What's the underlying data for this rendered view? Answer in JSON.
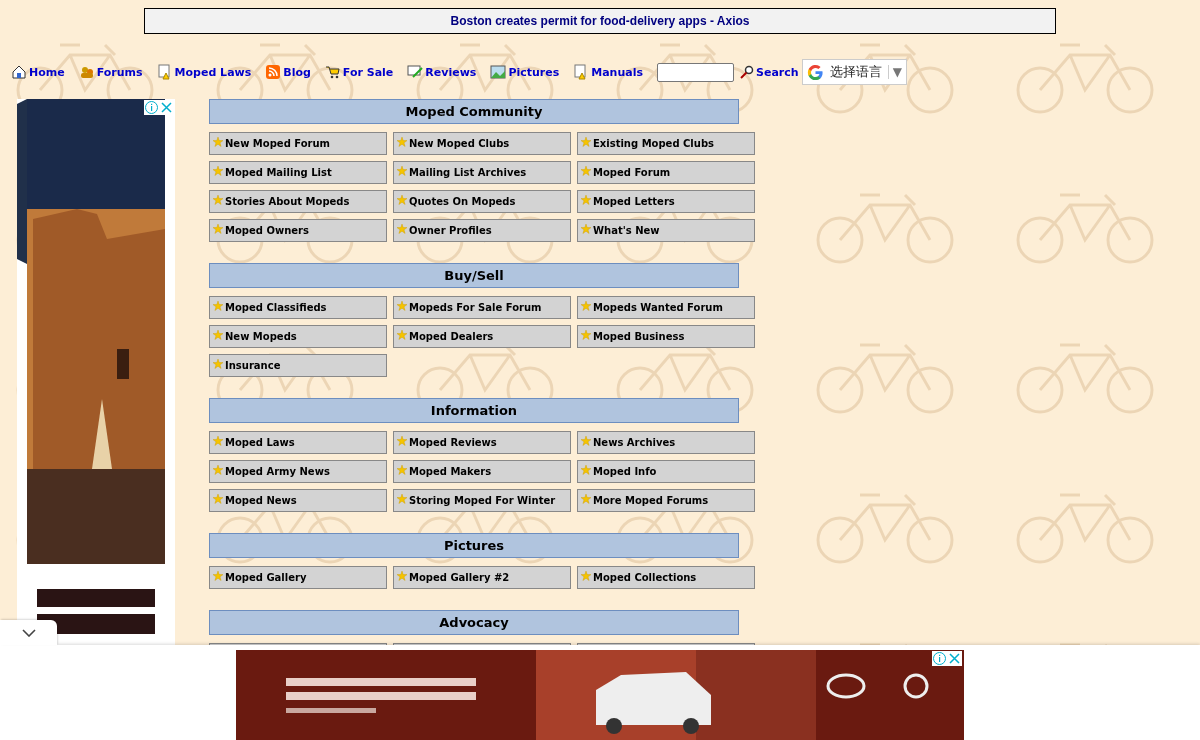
{
  "headline": {
    "text": "Boston creates permit for food-delivery apps - Axios"
  },
  "nav": {
    "items": [
      {
        "label": "Home"
      },
      {
        "label": "Forums"
      },
      {
        "label": "Moped Laws"
      },
      {
        "label": "Blog"
      },
      {
        "label": "For Sale"
      },
      {
        "label": "Reviews"
      },
      {
        "label": "Pictures"
      },
      {
        "label": "Manuals"
      }
    ],
    "search_button": "Search",
    "language": "选择语言",
    "language_caret": "▼"
  },
  "sections": [
    {
      "title": "Moped Community",
      "links": [
        "New Moped Forum",
        "New Moped Clubs",
        "Existing Moped Clubs",
        "Moped Mailing List",
        "Mailing List Archives",
        "Moped Forum",
        "Stories About Mopeds",
        "Quotes On Mopeds",
        "Moped Letters",
        "Moped Owners",
        "Owner Profiles",
        "What's New"
      ]
    },
    {
      "title": "Buy/Sell",
      "links": [
        "Moped Classifieds",
        "Mopeds For Sale Forum",
        "Mopeds Wanted Forum",
        "New Mopeds",
        "Moped Dealers",
        "Moped Business",
        "Insurance"
      ]
    },
    {
      "title": "Information",
      "links": [
        "Moped Laws",
        "Moped Reviews",
        "News Archives",
        "Moped Army News",
        "Moped Makers",
        "Moped Info",
        "Moped News",
        "Storing Moped For Winter",
        "More Moped Forums"
      ]
    },
    {
      "title": "Pictures",
      "links": [
        "Moped Gallery",
        "Moped Gallery #2",
        "Moped Collections"
      ]
    },
    {
      "title": "Advocacy"
    }
  ]
}
